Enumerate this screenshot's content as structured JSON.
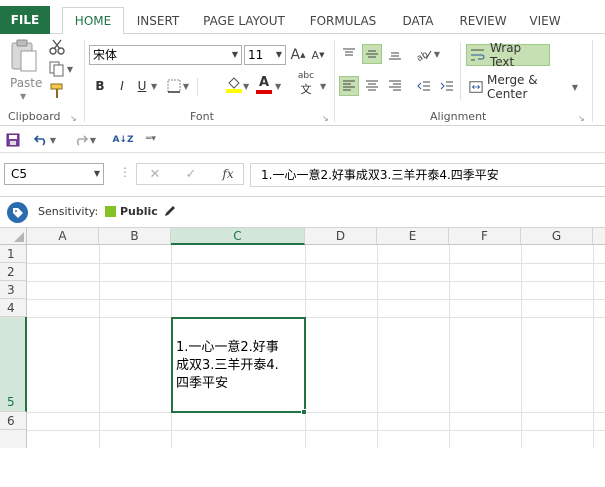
{
  "tabs": {
    "file": "FILE",
    "home": "HOME",
    "insert": "INSERT",
    "page_layout": "PAGE LAYOUT",
    "formulas": "FORMULAS",
    "data": "DATA",
    "review": "REVIEW",
    "view": "VIEW"
  },
  "ribbon": {
    "clipboard": {
      "paste_label": "Paste",
      "group_label": "Clipboard"
    },
    "font": {
      "font_name": "宋体",
      "font_size": "11",
      "bold": "B",
      "italic": "I",
      "underline": "U",
      "grow": "A",
      "shrink": "A",
      "font_color_label": "A",
      "phonetic": "abc",
      "group_label": "Font"
    },
    "alignment": {
      "wrap_text": "Wrap Text",
      "merge_center": "Merge & Center",
      "group_label": "Alignment"
    }
  },
  "qat": {
    "sort_label": "A↓Z"
  },
  "formula_bar": {
    "name_box": "C5",
    "fx": "fx",
    "cancel": "✕",
    "enter": "✓",
    "content": "1.一心一意2.好事成双3.三羊开泰4.四季平安"
  },
  "sensitivity": {
    "label": "Sensitivity:",
    "value": "Public"
  },
  "sheet": {
    "columns": [
      "A",
      "B",
      "C",
      "D",
      "E",
      "F",
      "G"
    ],
    "rows": [
      "1",
      "2",
      "3",
      "4",
      "5",
      "6"
    ],
    "selected_cell": "C5",
    "cell_c5_lines": [
      "1.一心一意2.好事",
      "成双3.三羊开泰4.",
      "四季平安"
    ]
  },
  "colors": {
    "accent": "#217346",
    "highlight": "#c6e0b4",
    "font_color": "#e00000",
    "fill_color": "#ffff00",
    "sensitivity_tag": "#84c225"
  }
}
